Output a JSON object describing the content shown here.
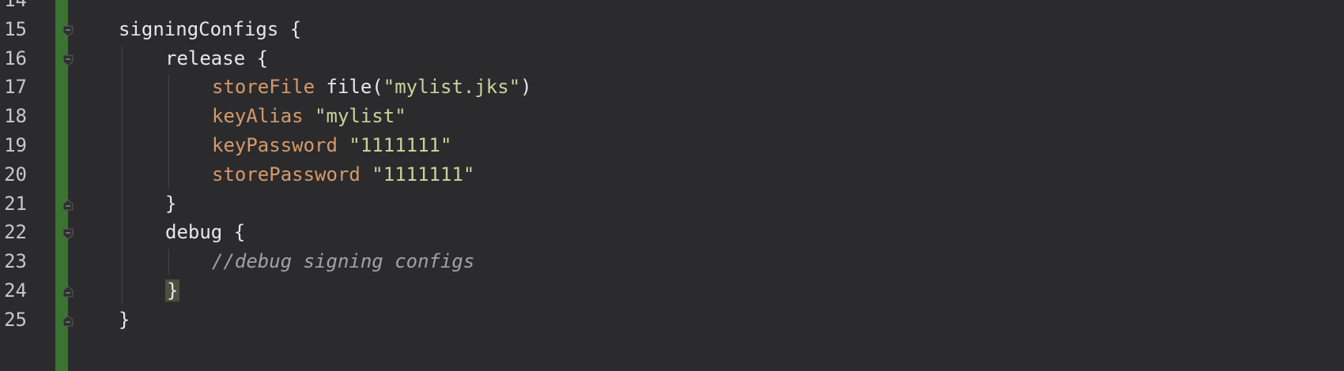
{
  "editor": {
    "lines": [
      {
        "number": "14",
        "tokens": []
      },
      {
        "number": "15",
        "fold": "open",
        "tokens": [
          {
            "text": "signingConfigs {",
            "kind": "plain"
          }
        ],
        "indent": 0
      },
      {
        "number": "16",
        "fold": "open",
        "tokens": [
          {
            "text": "release {",
            "kind": "plain"
          }
        ],
        "indent": 1
      },
      {
        "number": "17",
        "tokens": [
          {
            "text": "storeFile",
            "kind": "prop"
          },
          {
            "text": " file(",
            "kind": "plain"
          },
          {
            "text": "\"mylist.jks\"",
            "kind": "str"
          },
          {
            "text": ")",
            "kind": "plain"
          }
        ],
        "indent": 2
      },
      {
        "number": "18",
        "tokens": [
          {
            "text": "keyAlias",
            "kind": "prop"
          },
          {
            "text": " ",
            "kind": "plain"
          },
          {
            "text": "\"mylist\"",
            "kind": "str"
          }
        ],
        "indent": 2
      },
      {
        "number": "19",
        "tokens": [
          {
            "text": "keyPassword",
            "kind": "prop"
          },
          {
            "text": " ",
            "kind": "plain"
          },
          {
            "text": "\"1111111\"",
            "kind": "str"
          }
        ],
        "indent": 2
      },
      {
        "number": "20",
        "tokens": [
          {
            "text": "storePassword",
            "kind": "prop"
          },
          {
            "text": " ",
            "kind": "plain"
          },
          {
            "text": "\"1111111\"",
            "kind": "str"
          }
        ],
        "indent": 2
      },
      {
        "number": "21",
        "fold": "close",
        "tokens": [
          {
            "text": "}",
            "kind": "plain"
          }
        ],
        "indent": 1
      },
      {
        "number": "22",
        "fold": "open",
        "tokens": [
          {
            "text": "debug {",
            "kind": "plain"
          }
        ],
        "indent": 1
      },
      {
        "number": "23",
        "tokens": [
          {
            "text": "//debug signing configs",
            "kind": "comment"
          }
        ],
        "indent": 2
      },
      {
        "number": "24",
        "fold": "close",
        "tokens": [
          {
            "text": "}",
            "kind": "brace-hl"
          }
        ],
        "indent": 1
      },
      {
        "number": "25",
        "fold": "close",
        "tokens": [
          {
            "text": "}",
            "kind": "plain"
          }
        ],
        "indent": 0
      }
    ],
    "colors": {
      "background": "#2b2b2d",
      "vcs_added": "#3b7431",
      "property": "#d69a6b",
      "string": "#c8d39a",
      "plain": "#e8e8e8",
      "comment": "#a3a3a3",
      "brace_highlight": "#4c5040"
    },
    "fold_icon_open": "fold-open-icon",
    "fold_icon_close": "fold-close-icon"
  }
}
